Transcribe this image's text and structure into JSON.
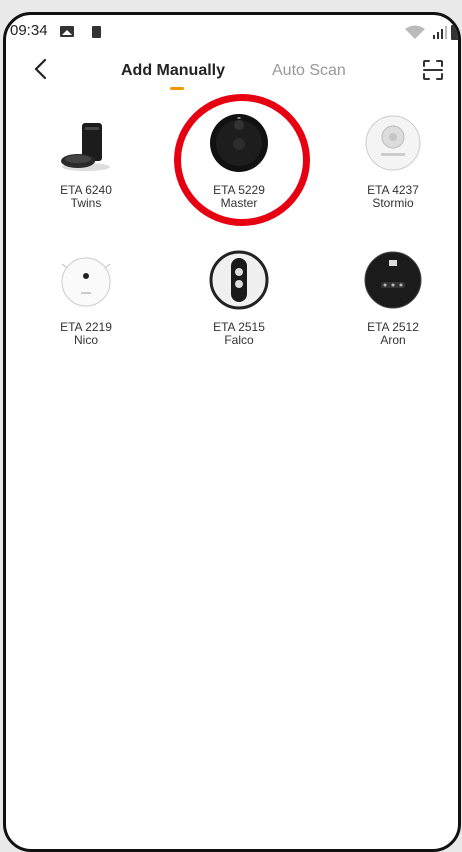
{
  "status_bar": {
    "time": "09:34"
  },
  "header": {
    "tabs": [
      {
        "label": "Add Manually"
      },
      {
        "label": "Auto Scan"
      }
    ]
  },
  "devices": [
    {
      "model": "ETA 6240",
      "name": "Twins"
    },
    {
      "model": "ETA 5229",
      "name": "Master"
    },
    {
      "model": "ETA 4237",
      "name": "Stormio"
    },
    {
      "model": "ETA 2219",
      "name": "Nico"
    },
    {
      "model": "ETA 2515",
      "name": "Falco"
    },
    {
      "model": "ETA 2512",
      "name": "Aron"
    }
  ],
  "colors": {
    "accent": "#f39800",
    "highlight": "#e60012"
  }
}
